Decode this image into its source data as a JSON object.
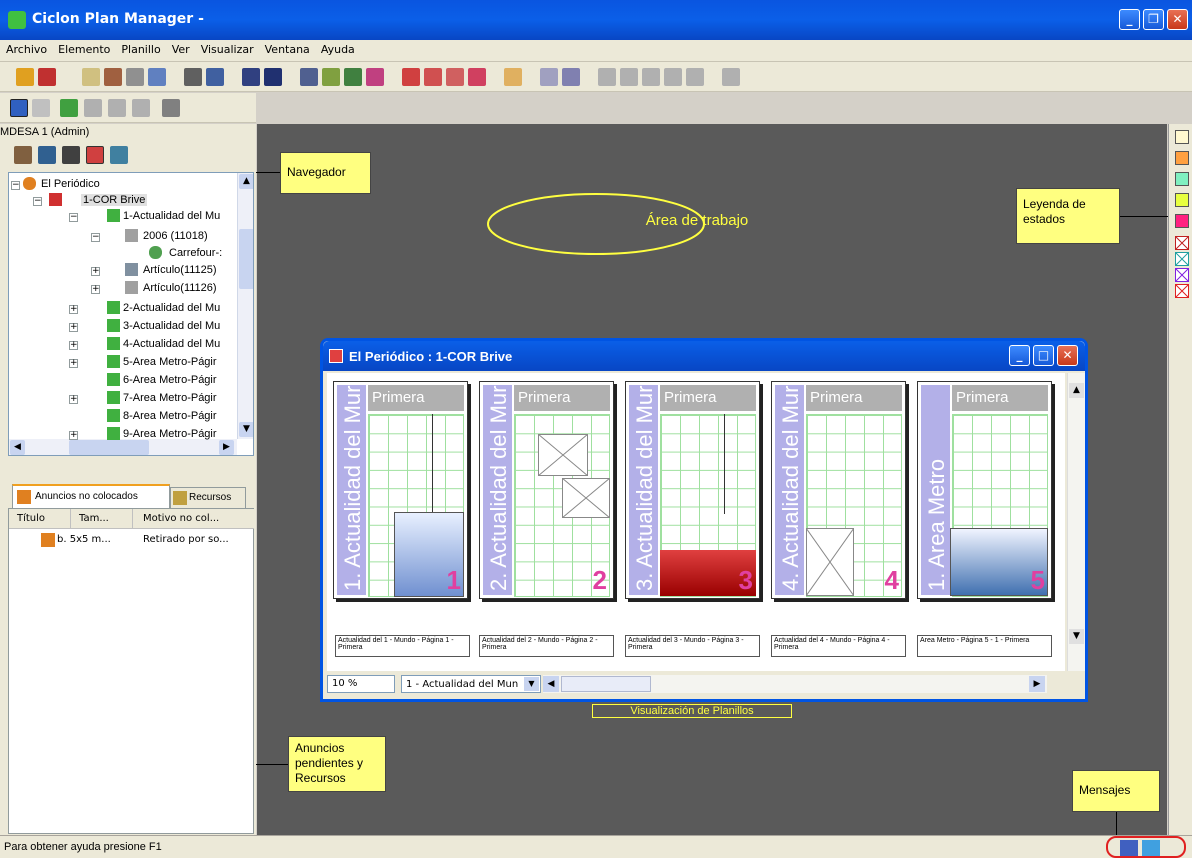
{
  "app": {
    "title": "Ciclon Plan Manager -"
  },
  "menu": [
    "Archivo",
    "Elemento",
    "Planillo",
    "Ver",
    "Visualizar",
    "Ventana",
    "Ayuda"
  ],
  "left": {
    "user": "MDESA 1 (Admin)",
    "tree": [
      {
        "label": "El Periódico"
      },
      {
        "label": "1-COR Brive"
      },
      {
        "label": "1-Actualidad del Mu"
      },
      {
        "label": "2006 (11018)"
      },
      {
        "label": "Carrefour-:"
      },
      {
        "label": "Artículo(11125)"
      },
      {
        "label": "Artículo(11126)"
      },
      {
        "label": "2-Actualidad del Mu"
      },
      {
        "label": "3-Actualidad del Mu"
      },
      {
        "label": "4-Actualidad del Mu"
      },
      {
        "label": "5-Area Metro-Págir"
      },
      {
        "label": "6-Area Metro-Págir"
      },
      {
        "label": "7-Area Metro-Págir"
      },
      {
        "label": "8-Area Metro-Págir"
      },
      {
        "label": "9-Area Metro-Págir"
      }
    ],
    "tabs": {
      "ads": "Anuncios no colocados",
      "resources": "Recursos"
    },
    "columns": [
      "Título",
      "Tam...",
      "Motivo no col..."
    ],
    "row": {
      "title": "b. 5x5 m...",
      "reason": "Retirado por so..."
    }
  },
  "notes": {
    "navegador": "Navegador",
    "area": "Área de trabajo",
    "leyenda_1": "Leyenda de",
    "leyenda_2": "estados",
    "visualizacion": "Visualización de Planillos",
    "anuncios_1": "Anuncios",
    "anuncios_2": "pendientes y",
    "anuncios_3": "Recursos",
    "mensajes": "Mensajes"
  },
  "inner": {
    "title": "El Periódico : 1-COR Brive",
    "zoom": "10 %",
    "select": "1 - Actualidad del Mun",
    "pages": [
      {
        "side": "1. Actualidad del Mur",
        "head": "Primera",
        "num": "1",
        "label": "Actualidad del 1 - Mundo - Página 1 - Primera"
      },
      {
        "side": "2. Actualidad del Mur",
        "head": "Primera",
        "num": "2",
        "label": "Actualidad del 2 - Mundo - Página 2 - Primera"
      },
      {
        "side": "3. Actualidad del Mur",
        "head": "Primera",
        "num": "3",
        "label": "Actualidad del 3 - Mundo - Página 3 - Primera"
      },
      {
        "side": "4. Actualidad del Mur",
        "head": "Primera",
        "num": "4",
        "label": "Actualidad del 4 - Mundo - Página 4 - Primera"
      },
      {
        "side": "1. Area Metro",
        "head": "Primera",
        "num": "5",
        "label": "Area Metro - Página 5 - 1 - Primera"
      }
    ]
  },
  "status": {
    "text": "Para obtener ayuda presione F1"
  },
  "legend_colors": [
    "#fff8d0",
    "#ffa040",
    "#80f0c0",
    "#e8ff40",
    "#ff2080"
  ]
}
